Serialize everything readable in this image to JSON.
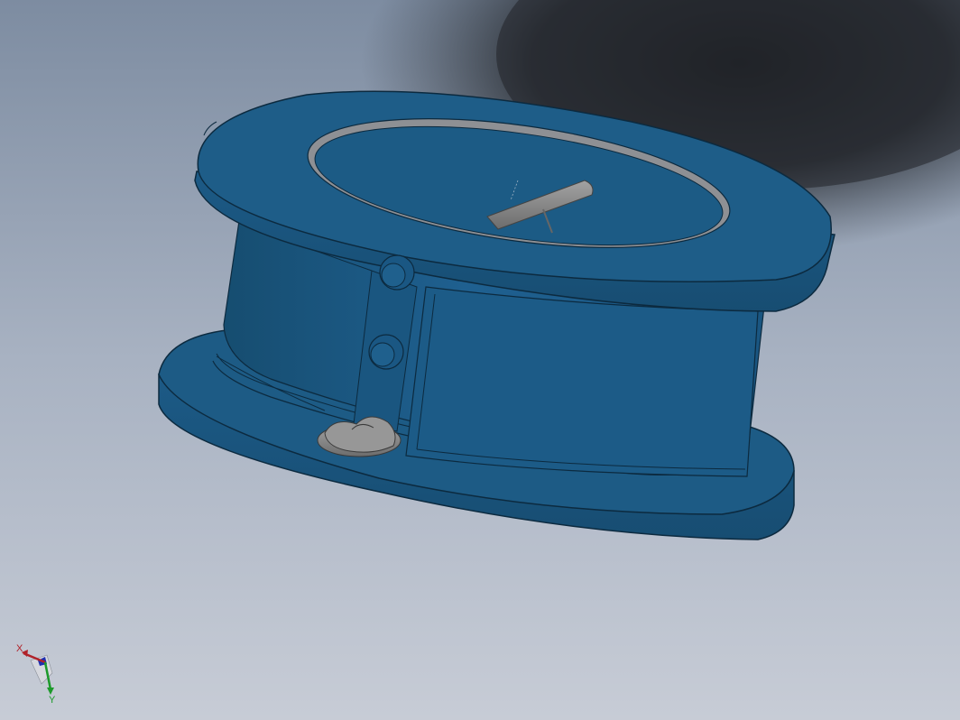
{
  "viewport": {
    "background_top": "#7e8da2",
    "background_bottom": "#c3c8d3",
    "shadow_color": "#1f2226"
  },
  "model": {
    "body_color": "#1d5b84",
    "body_dark": "#164b6e",
    "edge_color": "#0c2a3f",
    "metal_color": "#8e8e8e",
    "metal_dark": "#6a6a6a"
  },
  "triad": {
    "x_label": "X",
    "y_label": "Y",
    "x_color": "#b0222a",
    "y_color": "#1c9a2a",
    "z_color": "#1f2fb0"
  }
}
